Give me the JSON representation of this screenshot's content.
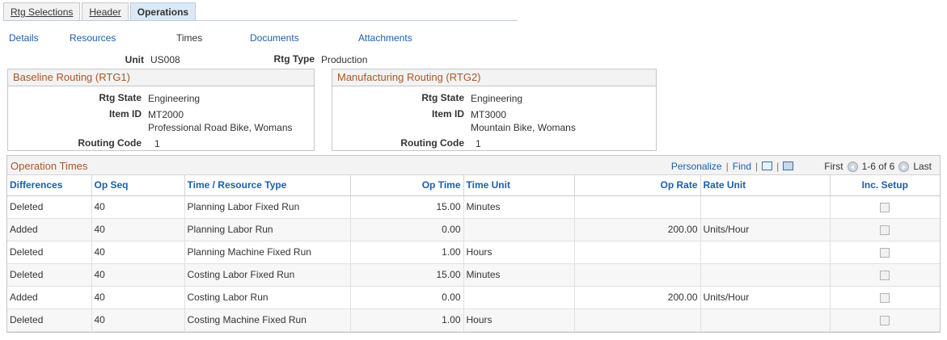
{
  "tabs": [
    {
      "label": "Rtg Selections"
    },
    {
      "label": "Header"
    },
    {
      "label": "Operations"
    }
  ],
  "subnav": {
    "details": "Details",
    "resources": "Resources",
    "times": "Times",
    "documents": "Documents",
    "attachments": "Attachments"
  },
  "header": {
    "unit_label": "Unit",
    "unit_value": "US008",
    "rtg_type_label": "Rtg Type",
    "rtg_type_value": "Production"
  },
  "baseline": {
    "title": "Baseline Routing (RTG1)",
    "rtg_state_label": "Rtg State",
    "rtg_state_value": "Engineering",
    "item_id_label": "Item ID",
    "item_id_value": "MT2000",
    "item_desc": "Professional Road Bike, Womans",
    "routing_code_label": "Routing Code",
    "routing_code_value": "1"
  },
  "manufacturing": {
    "title": "Manufacturing Routing (RTG2)",
    "rtg_state_label": "Rtg State",
    "rtg_state_value": "Engineering",
    "item_id_label": "Item ID",
    "item_id_value": "MT3000",
    "item_desc": "Mountain Bike, Womans",
    "routing_code_label": "Routing Code",
    "routing_code_value": "1"
  },
  "grid": {
    "title": "Operation Times",
    "personalize": "Personalize",
    "find": "Find",
    "first": "First",
    "range": "1-6 of 6",
    "last": "Last",
    "columns": {
      "differences": "Differences",
      "op_seq": "Op Seq",
      "type": "Time / Resource Type",
      "op_time": "Op Time",
      "time_unit": "Time Unit",
      "op_rate": "Op Rate",
      "rate_unit": "Rate Unit",
      "inc_setup": "Inc. Setup"
    },
    "rows": [
      {
        "diff": "Deleted",
        "seq": "40",
        "type": "Planning Labor Fixed Run",
        "op_time": "15.00",
        "time_unit": "Minutes",
        "op_rate": "",
        "rate_unit": ""
      },
      {
        "diff": "Added",
        "seq": "40",
        "type": "Planning Labor Run",
        "op_time": "0.00",
        "time_unit": "",
        "op_rate": "200.00",
        "rate_unit": "Units/Hour"
      },
      {
        "diff": "Deleted",
        "seq": "40",
        "type": "Planning Machine Fixed Run",
        "op_time": "1.00",
        "time_unit": "Hours",
        "op_rate": "",
        "rate_unit": ""
      },
      {
        "diff": "Deleted",
        "seq": "40",
        "type": "Costing Labor Fixed Run",
        "op_time": "15.00",
        "time_unit": "Minutes",
        "op_rate": "",
        "rate_unit": ""
      },
      {
        "diff": "Added",
        "seq": "40",
        "type": "Costing Labor Run",
        "op_time": "0.00",
        "time_unit": "",
        "op_rate": "200.00",
        "rate_unit": "Units/Hour"
      },
      {
        "diff": "Deleted",
        "seq": "40",
        "type": "Costing Machine Fixed Run",
        "op_time": "1.00",
        "time_unit": "Hours",
        "op_rate": "",
        "rate_unit": ""
      }
    ]
  },
  "colors": {
    "link": "#1d5fa8",
    "group_title": "#a8562a",
    "active_tab": "#dbe8f5"
  }
}
